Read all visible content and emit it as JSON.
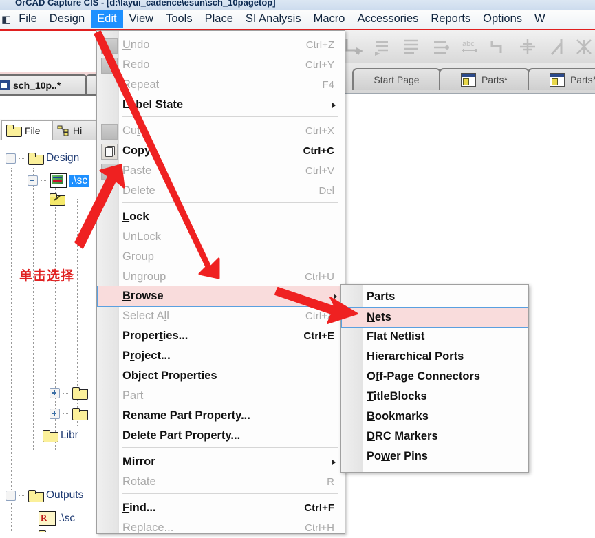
{
  "window": {
    "title": "OrCAD Capture CIS   -  [d:\\layui_cadence\\esun\\sch_10pagetop]"
  },
  "menubar": {
    "system_glyph": "◧",
    "items": [
      {
        "label": "File",
        "active": false
      },
      {
        "label": "Design",
        "active": false
      },
      {
        "label": "Edit",
        "active": true
      },
      {
        "label": "View",
        "active": false
      },
      {
        "label": "Tools",
        "active": false
      },
      {
        "label": "Place",
        "active": false
      },
      {
        "label": "SI Analysis",
        "active": false
      },
      {
        "label": "Macro",
        "active": false
      },
      {
        "label": "Accessories",
        "active": false
      },
      {
        "label": "Reports",
        "active": false
      },
      {
        "label": "Options",
        "active": false
      },
      {
        "label": "W",
        "active": false
      }
    ]
  },
  "doc_tabs": [
    {
      "label": "Start Page",
      "has_icon": false
    },
    {
      "label": "Parts*",
      "has_icon": true
    },
    {
      "label": "Parts*",
      "has_icon": true
    }
  ],
  "left_tab": {
    "label": "sch_10p..*"
  },
  "tree_tabs": [
    {
      "label": "File",
      "icon": "folder-icon",
      "selected": true
    },
    {
      "label": "Hi",
      "icon": "hierarchy-icon",
      "selected": false
    }
  ],
  "tree": {
    "nodes": [
      {
        "label": "Design",
        "icon": "folder-icon",
        "expander": "minus",
        "selected": false
      },
      {
        "label": ".\\sc",
        "icon": "schematic-icon",
        "expander": "minus",
        "selected": true
      },
      {
        "label": "",
        "icon": "folder-pencil-icon",
        "expander": "none",
        "selected": false
      },
      {
        "label": "",
        "icon": "folder-icon",
        "expander": "plus",
        "selected": false
      },
      {
        "label": "",
        "icon": "folder-icon",
        "expander": "plus",
        "selected": false
      },
      {
        "label": "Libr",
        "icon": "folder-icon",
        "expander": "none",
        "selected": false
      },
      {
        "label": "Outputs",
        "icon": "folder-icon",
        "expander": "minus",
        "selected": false
      },
      {
        "label": ".\\sc",
        "icon": "report-icon",
        "expander": "none",
        "selected": false
      }
    ]
  },
  "annotation": {
    "text": "单击选择"
  },
  "edit_menu": {
    "items": [
      {
        "label": "Undo",
        "accel": "Ctrl+Z",
        "enabled": false,
        "submenu": false,
        "gutter_icon": "blank-icon",
        "mnemonic": 1
      },
      {
        "label": "Redo",
        "accel": "Ctrl+Y",
        "enabled": false,
        "submenu": false,
        "gutter_icon": "blank-icon",
        "mnemonic": 1
      },
      {
        "label": "Repeat",
        "accel": "F4",
        "enabled": false,
        "submenu": false,
        "gutter_icon": "none",
        "mnemonic": 1
      },
      {
        "label": "Label State",
        "accel": "",
        "enabled": true,
        "submenu": true,
        "gutter_icon": "none",
        "mnemonic": 3
      },
      {
        "separator_after": true
      },
      {
        "label": "Cut",
        "accel": "Ctrl+X",
        "enabled": false,
        "submenu": false,
        "gutter_icon": "blank-icon",
        "mnemonic": 2
      },
      {
        "label": "Copy",
        "accel": "Ctrl+C",
        "enabled": true,
        "submenu": false,
        "gutter_icon": "copy-icon",
        "mnemonic": 0
      },
      {
        "label": "Paste",
        "accel": "Ctrl+V",
        "enabled": false,
        "submenu": false,
        "gutter_icon": "blank-icon",
        "mnemonic": 0
      },
      {
        "label": "Delete",
        "accel": "Del",
        "enabled": false,
        "submenu": false,
        "gutter_icon": "none",
        "mnemonic": 0
      },
      {
        "separator_after": true
      },
      {
        "label": "Lock",
        "accel": "",
        "enabled": true,
        "submenu": false,
        "gutter_icon": "none",
        "mnemonic": 0
      },
      {
        "label": "UnLock",
        "accel": "",
        "enabled": false,
        "submenu": false,
        "gutter_icon": "none",
        "mnemonic": 2
      },
      {
        "label": "Group",
        "accel": "",
        "enabled": false,
        "submenu": false,
        "gutter_icon": "none",
        "mnemonic": 0
      },
      {
        "label": "Ungroup",
        "accel": "Ctrl+U",
        "enabled": false,
        "submenu": false,
        "gutter_icon": "none",
        "mnemonic": 2
      },
      {
        "separator_after": true
      },
      {
        "label": "Browse",
        "accel": "",
        "enabled": true,
        "submenu": true,
        "gutter_icon": "none",
        "mnemonic": 0,
        "highlighted": true
      },
      {
        "label": "Select All",
        "accel": "Ctrl+A",
        "enabled": false,
        "submenu": false,
        "gutter_icon": "none",
        "mnemonic": 9
      },
      {
        "label": "Properties...",
        "accel": "Ctrl+E",
        "enabled": true,
        "submenu": false,
        "gutter_icon": "none",
        "mnemonic": 8
      },
      {
        "label": "Project...",
        "accel": "",
        "enabled": true,
        "submenu": false,
        "gutter_icon": "none",
        "mnemonic": 1
      },
      {
        "label": "Object Properties",
        "accel": "",
        "enabled": true,
        "submenu": false,
        "gutter_icon": "none",
        "mnemonic": 0
      },
      {
        "label": "Part",
        "accel": "",
        "enabled": false,
        "submenu": false,
        "gutter_icon": "none",
        "mnemonic": 1
      },
      {
        "label": "Rename Part Property...",
        "accel": "",
        "enabled": true,
        "submenu": false,
        "gutter_icon": "none",
        "mnemonic": 0
      },
      {
        "label": "Delete Part Property...",
        "accel": "",
        "enabled": true,
        "submenu": false,
        "gutter_icon": "none",
        "mnemonic": 0
      },
      {
        "separator_after": true
      },
      {
        "label": "Mirror",
        "accel": "",
        "enabled": true,
        "submenu": true,
        "gutter_icon": "none",
        "mnemonic": 1
      },
      {
        "label": "Rotate",
        "accel": "R",
        "enabled": false,
        "submenu": false,
        "gutter_icon": "none",
        "mnemonic": 1
      },
      {
        "separator_after": true
      },
      {
        "label": "Find...",
        "accel": "Ctrl+F",
        "enabled": true,
        "submenu": false,
        "gutter_icon": "none",
        "mnemonic": 0
      },
      {
        "label": "Replace...",
        "accel": "Ctrl+H",
        "enabled": false,
        "submenu": false,
        "gutter_icon": "none",
        "mnemonic": 0
      }
    ]
  },
  "browse_submenu": {
    "items": [
      {
        "label": "Parts",
        "mnemonic": 0,
        "highlighted": false
      },
      {
        "label": "Nets",
        "mnemonic": 0,
        "highlighted": true
      },
      {
        "label": "Flat Netlist",
        "mnemonic": 0,
        "highlighted": false
      },
      {
        "label": "Hierarchical Ports",
        "mnemonic": 0,
        "highlighted": false
      },
      {
        "label": "Off-Page Connectors",
        "mnemonic": 1,
        "highlighted": false
      },
      {
        "label": "TitleBlocks",
        "mnemonic": 0,
        "highlighted": false
      },
      {
        "label": "Bookmarks",
        "mnemonic": 0,
        "highlighted": false
      },
      {
        "label": "DRC Markers",
        "mnemonic": 0,
        "highlighted": false
      },
      {
        "label": "Power Pins",
        "mnemonic": 2,
        "highlighted": false
      }
    ]
  },
  "colors": {
    "accent_blue": "#1e90ff",
    "annotation_red": "#e02020",
    "highlight_pink": "#f9dcdc",
    "highlight_border": "#5aa0e0",
    "menu_bg": "#fdfdfd"
  }
}
